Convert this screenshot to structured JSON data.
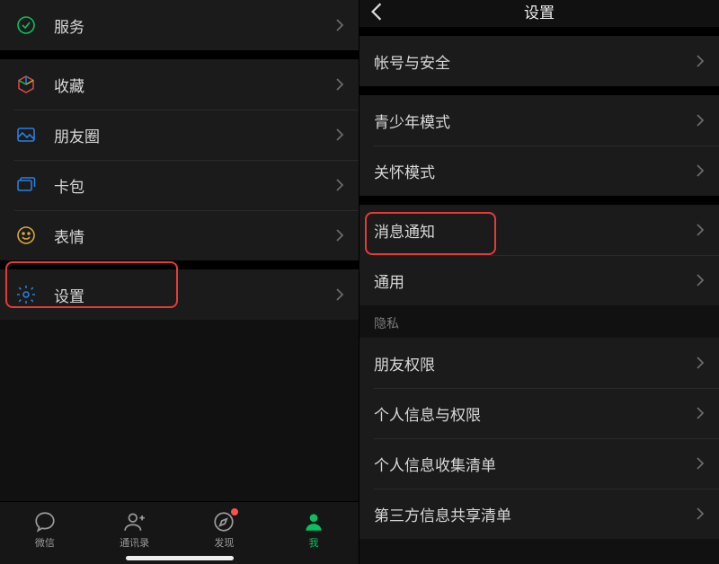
{
  "left": {
    "menu": [
      {
        "id": "services",
        "label": "服务",
        "icon": "services-icon",
        "color": "#07c160"
      },
      {
        "id": "favorites",
        "label": "收藏",
        "icon": "cube-icon",
        "color": "multi"
      },
      {
        "id": "moments",
        "label": "朋友圈",
        "icon": "image-icon",
        "color": "#2a7fdd"
      },
      {
        "id": "cards",
        "label": "卡包",
        "icon": "cards-icon",
        "color": "#2a7fdd"
      },
      {
        "id": "emoji",
        "label": "表情",
        "icon": "smile-icon",
        "color": "#d6a73b"
      },
      {
        "id": "settings",
        "label": "设置",
        "icon": "gear-icon",
        "color": "#2a7fdd",
        "highlighted": true
      }
    ],
    "tabs": [
      {
        "id": "chats",
        "label": "微信",
        "icon": "chat-icon"
      },
      {
        "id": "contacts",
        "label": "通讯录",
        "icon": "contacts-icon"
      },
      {
        "id": "discover",
        "label": "发现",
        "icon": "compass-icon",
        "badge": true
      },
      {
        "id": "me",
        "label": "我",
        "icon": "person-icon",
        "active": true
      }
    ]
  },
  "right": {
    "title": "设置",
    "groups": [
      {
        "items": [
          {
            "id": "account",
            "label": "帐号与安全"
          }
        ]
      },
      {
        "items": [
          {
            "id": "teen",
            "label": "青少年模式"
          },
          {
            "id": "care",
            "label": "关怀模式"
          }
        ]
      },
      {
        "items": [
          {
            "id": "notifications",
            "label": "消息通知",
            "highlighted": true
          },
          {
            "id": "general",
            "label": "通用"
          }
        ]
      },
      {
        "title": "隐私",
        "items": [
          {
            "id": "friend-perm",
            "label": "朋友权限"
          },
          {
            "id": "personal-info",
            "label": "个人信息与权限"
          },
          {
            "id": "info-collect",
            "label": "个人信息收集清单"
          },
          {
            "id": "thirdparty-share",
            "label": "第三方信息共享清单"
          }
        ]
      }
    ]
  }
}
